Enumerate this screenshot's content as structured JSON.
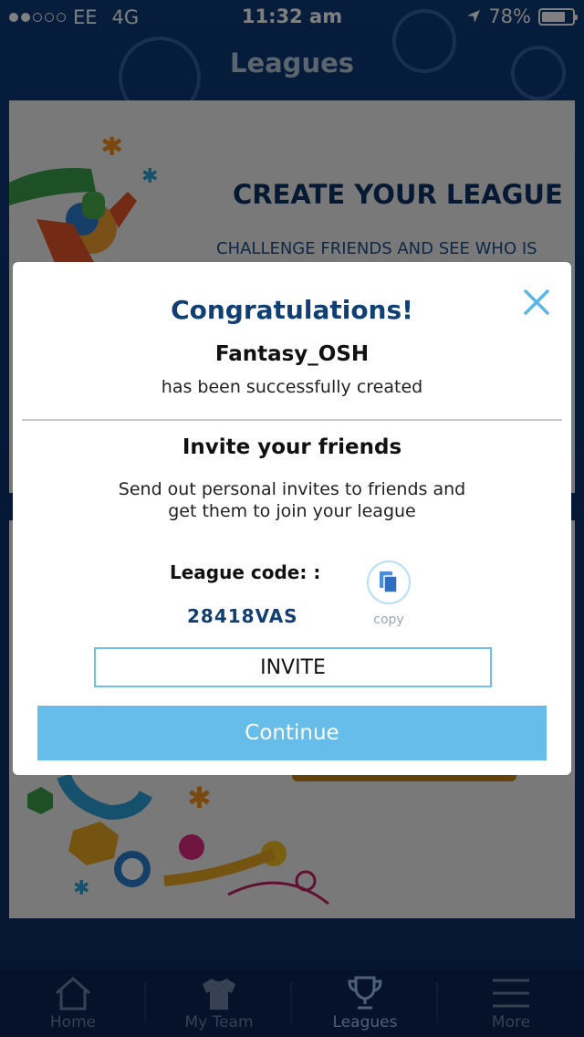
{
  "status_bar": {
    "carrier": "EE",
    "network": "4G",
    "time": "11:32 am",
    "battery": "78%",
    "battery_level": 0.78,
    "signal_bars_filled": 2,
    "signal_bars_total": 5
  },
  "nav": {
    "title": "Leagues"
  },
  "background_card": {
    "heading": "CREATE YOUR LEAGUE",
    "subheading": "CHALLENGE FRIENDS AND SEE WHO IS"
  },
  "modal": {
    "title": "Congratulations!",
    "league_name": "Fantasy_OSH",
    "created_text": "has been successfully created",
    "invite_title": "Invite your friends",
    "invite_desc": "Send out personal invites to friends and get them to join your league",
    "code_label": "League code: :",
    "code_value": "28418VAS",
    "copy_label": "copy",
    "invite_button": "INVITE",
    "continue_button": "Continue"
  },
  "tabbar": {
    "tabs": [
      {
        "label": "Home",
        "icon": "home-icon"
      },
      {
        "label": "My Team",
        "icon": "shirt-icon"
      },
      {
        "label": "Leagues",
        "icon": "trophy-icon",
        "active": true
      },
      {
        "label": "More",
        "icon": "menu-icon"
      }
    ]
  },
  "colors": {
    "primary_dark": "#123f73",
    "accent": "#67bde9",
    "background": "#0b2f63"
  }
}
